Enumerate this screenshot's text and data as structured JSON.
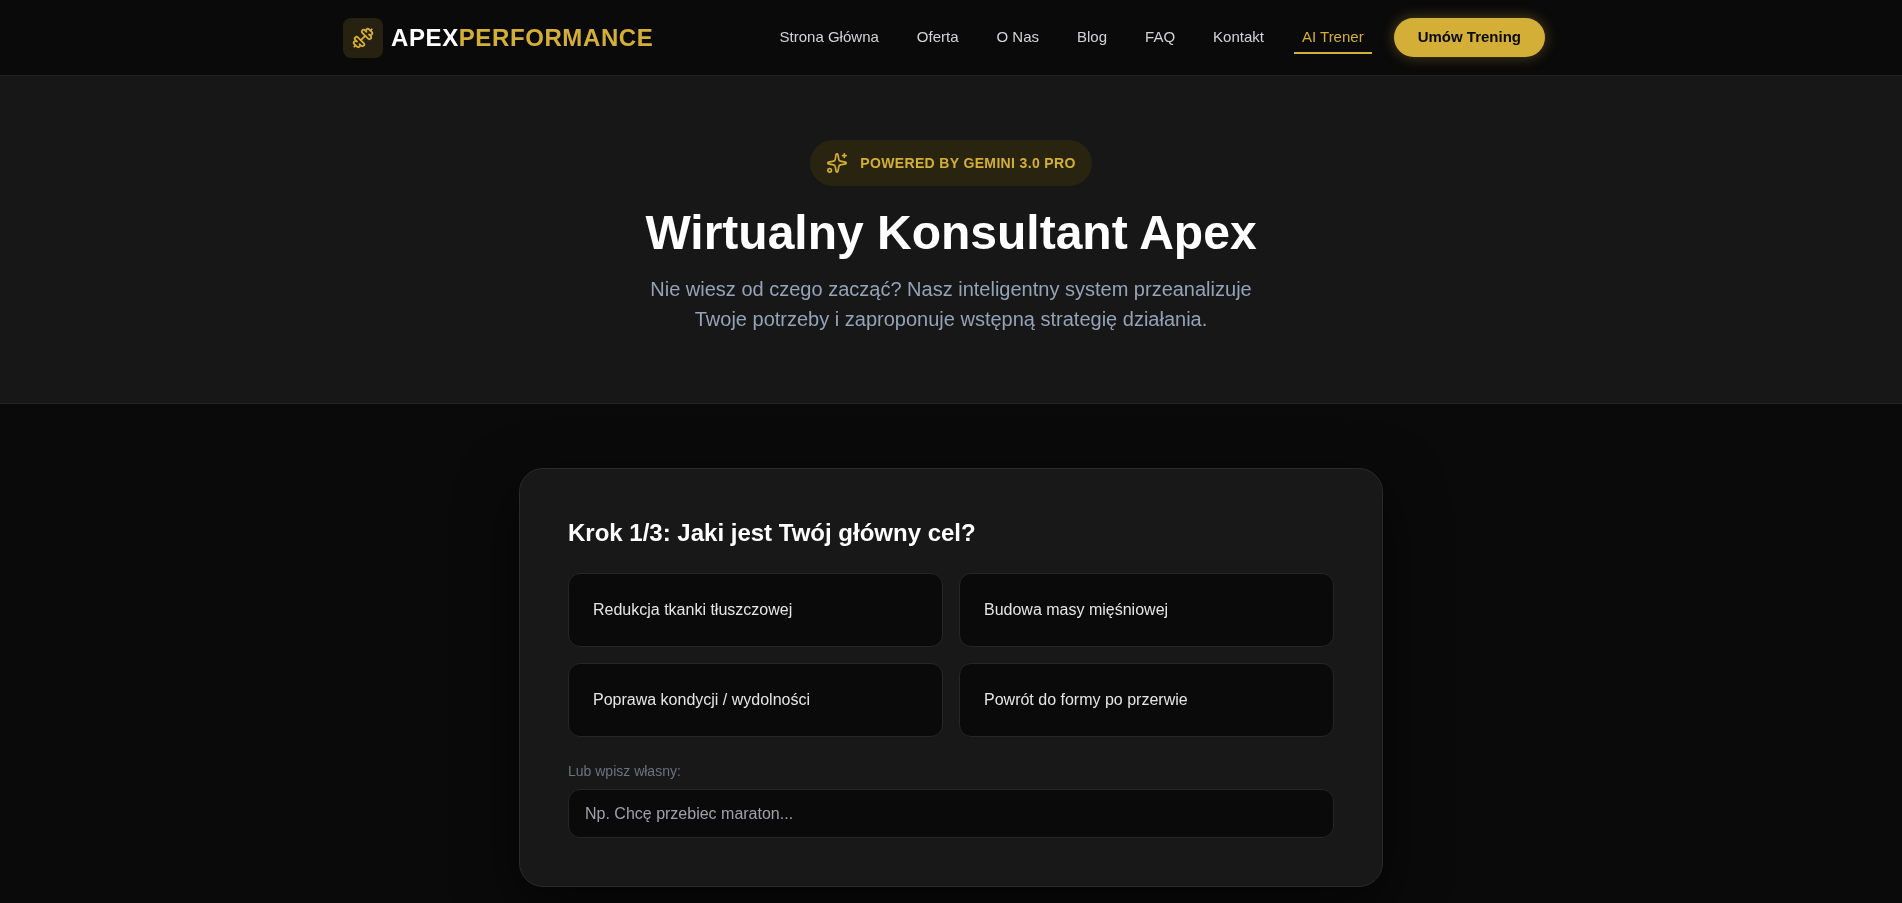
{
  "header": {
    "logo": {
      "text": "APEX",
      "accent_text": "PERFORMANCE"
    },
    "nav": [
      {
        "label": "Strona Główna",
        "selected": false
      },
      {
        "label": "Oferta",
        "selected": false
      },
      {
        "label": "O Nas",
        "selected": false
      },
      {
        "label": "Blog",
        "selected": false
      },
      {
        "label": "FAQ",
        "selected": false
      },
      {
        "label": "Kontakt",
        "selected": false
      },
      {
        "label": "AI Trener",
        "selected": true
      }
    ],
    "cta_button": "Umów Trening"
  },
  "hero": {
    "badge": "POWERED BY GEMINI 3.0 PRO",
    "title": "Wirtualny Konsultant Apex",
    "subtitle": "Nie wiesz od czego zacząć? Nasz inteligentny system przeanalizuje Twoje potrzeby i zaproponuje wstępną strategię działania."
  },
  "wizard": {
    "step_title": "Krok 1/3: Jaki jest Twój główny cel?",
    "options": [
      {
        "label": "Redukcja tkanki tłuszczowej",
        "selected": false
      },
      {
        "label": "Budowa masy mięśniowej",
        "selected": false
      },
      {
        "label": "Poprawa kondycji / wydolności",
        "selected": false
      },
      {
        "label": "Powrót do formy po przerwie",
        "selected": false
      }
    ],
    "custom_label": "Lub wpisz własny:",
    "custom_input": {
      "placeholder": "Np. Chcę przebiec maraton..."
    }
  }
}
